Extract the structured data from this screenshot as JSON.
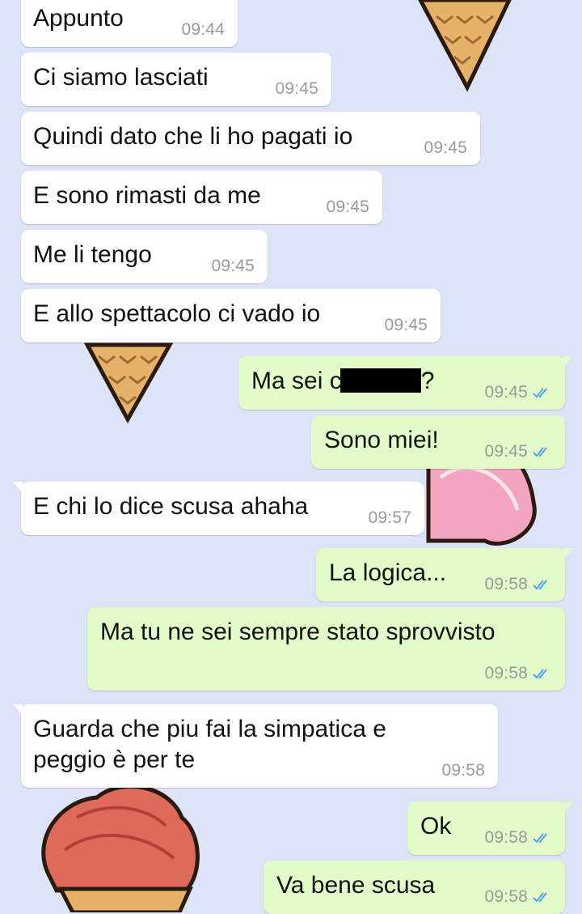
{
  "theme": {
    "wallpaper": "#dde4f7",
    "incoming_bubble": "#ffffff",
    "outgoing_bubble": "#e2fbc8",
    "read_tick_color": "#4fa6e6"
  },
  "messages": [
    {
      "direction": "in",
      "text": "Appunto",
      "time": "09:44"
    },
    {
      "direction": "in",
      "text": "Ci siamo lasciati",
      "time": "09:45"
    },
    {
      "direction": "in",
      "text": "Quindi dato che li ho pagati io",
      "time": "09:45"
    },
    {
      "direction": "in",
      "text": "E sono rimasti da me",
      "time": "09:45"
    },
    {
      "direction": "in",
      "text": "Me li tengo",
      "time": "09:45"
    },
    {
      "direction": "in",
      "text": "E allo spettacolo ci vado io",
      "time": "09:45"
    },
    {
      "direction": "out",
      "text_before": "Ma sei c",
      "text_after": "?",
      "time": "09:45",
      "status": "read-ticks-icon"
    },
    {
      "direction": "out",
      "text": "Sono miei!",
      "time": "09:45",
      "status": "read-ticks-icon"
    },
    {
      "direction": "in",
      "text": "E chi lo dice scusa ahaha",
      "time": "09:57"
    },
    {
      "direction": "out",
      "text": "La logica...",
      "time": "09:58",
      "status": "read-ticks-icon"
    },
    {
      "direction": "out",
      "text": "Ma tu ne sei sempre stato sprovvisto",
      "time": "09:58",
      "status": "read-ticks-icon"
    },
    {
      "direction": "in",
      "text": "Guarda che piu fai la simpatica e\npeggio è per te",
      "time": "09:58"
    },
    {
      "direction": "out",
      "text": "Ok",
      "time": "09:58",
      "status": "read-ticks-icon"
    },
    {
      "direction": "out",
      "text": "Va bene scusa",
      "time": "09:58",
      "status": "read-ticks-icon"
    }
  ],
  "wallpaper_icons": [
    "ice-cream-cone-icon",
    "ice-cream-pink-icon",
    "ice-cream-red-icon"
  ]
}
